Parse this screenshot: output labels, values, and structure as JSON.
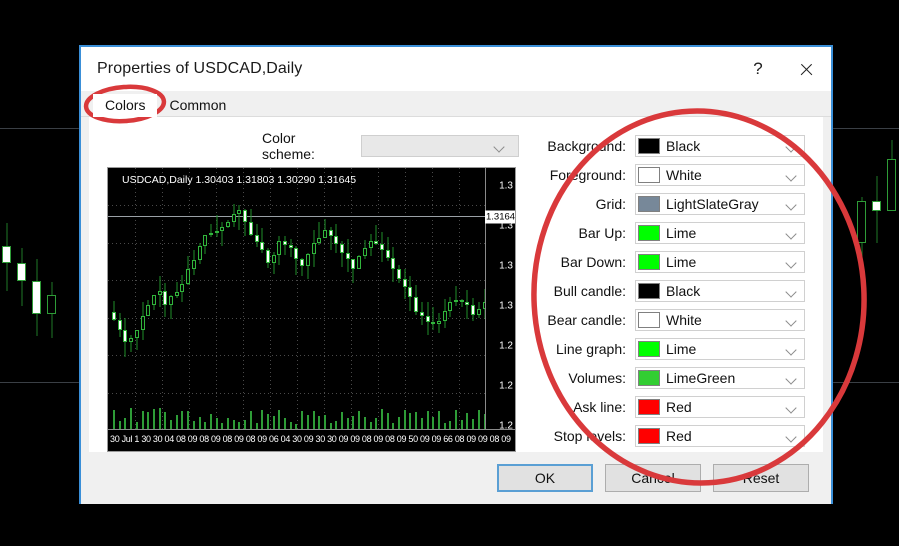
{
  "window": {
    "title": "Properties of USDCAD,Daily",
    "help_label": "?",
    "close_label": "close-icon"
  },
  "tabs": [
    {
      "label": "Colors",
      "active": true
    },
    {
      "label": "Common",
      "active": false
    }
  ],
  "scheme": {
    "label": "Color scheme:",
    "value": "",
    "placeholder": ""
  },
  "preview": {
    "header": "USDCAD,Daily  1.30403 1.31803 1.30290 1.31645",
    "price_tag": "1.3164",
    "y_ticks": [
      "1.3",
      "1.3",
      "1.3",
      "1.3",
      "1.2",
      "1.2",
      "1.2"
    ],
    "time_labels": "30 Jul 1 30 30 04 08 09 08 09 08 09 08 09 06 04 30 09 30 30 09 09 08 09 08 09 50 09 09 66 08 09 09 08 09"
  },
  "colors": [
    {
      "label": "Background:",
      "value": "Black",
      "hex": "#000000"
    },
    {
      "label": "Foreground:",
      "value": "White",
      "hex": "#ffffff"
    },
    {
      "label": "Grid:",
      "value": "LightSlateGray",
      "hex": "#778899"
    },
    {
      "label": "Bar Up:",
      "value": "Lime",
      "hex": "#00ff00"
    },
    {
      "label": "Bar Down:",
      "value": "Lime",
      "hex": "#00ff00"
    },
    {
      "label": "Bull candle:",
      "value": "Black",
      "hex": "#000000"
    },
    {
      "label": "Bear candle:",
      "value": "White",
      "hex": "#ffffff"
    },
    {
      "label": "Line graph:",
      "value": "Lime",
      "hex": "#00ff00"
    },
    {
      "label": "Volumes:",
      "value": "LimeGreen",
      "hex": "#32cd32"
    },
    {
      "label": "Ask line:",
      "value": "Red",
      "hex": "#ff0000"
    },
    {
      "label": "Stop levels:",
      "value": "Red",
      "hex": "#ff0000"
    }
  ],
  "buttons": {
    "ok": "OK",
    "cancel": "Cancel",
    "reset": "Reset"
  },
  "annotations": {
    "accent_color": "#d9393b",
    "tab_highlight": "Colors",
    "panel_highlight": "colors-panel"
  },
  "background_chart": {
    "symbol": "USDCAD",
    "style": "candlestick",
    "bull_color": "#000000",
    "bear_color": "#ffffff",
    "outline_color": "#2e9c37",
    "background": "#000000"
  }
}
